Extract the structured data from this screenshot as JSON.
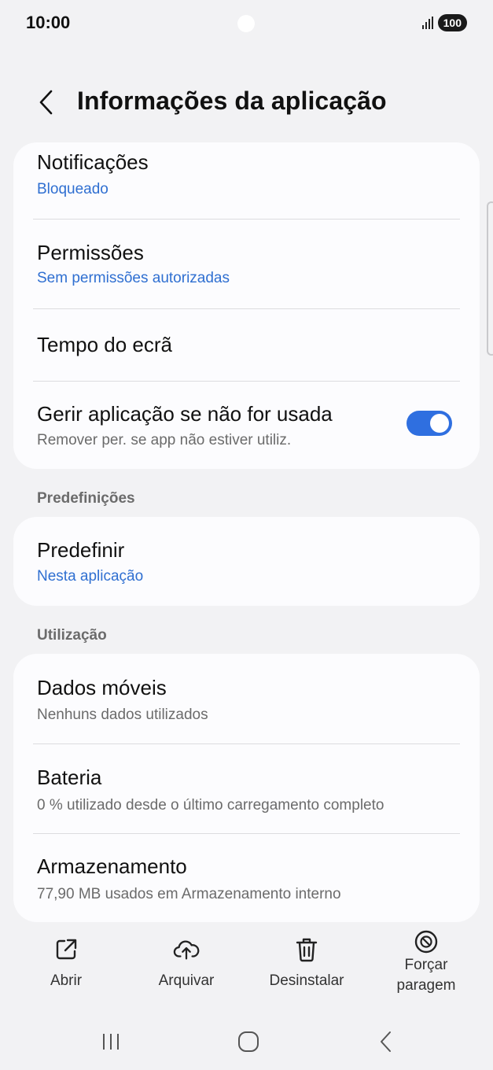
{
  "status_bar": {
    "time": "10:00",
    "battery": "100"
  },
  "header": {
    "title": "Informações da aplicação"
  },
  "card1": {
    "notifications": {
      "title": "Notificações",
      "subtitle": "Bloqueado"
    },
    "permissions": {
      "title": "Permissões",
      "subtitle": "Sem permissões autorizadas"
    },
    "screen_time": {
      "title": "Tempo do ecrã"
    },
    "manage_unused": {
      "title": "Gerir aplicação se não for usada",
      "subtitle": "Remover per. se app não estiver utiliz.",
      "toggle_on": true
    }
  },
  "defaults_section": {
    "label": "Predefinições",
    "set_default": {
      "title": "Predefinir",
      "subtitle": "Nesta aplicação"
    }
  },
  "usage_section": {
    "label": "Utilização",
    "mobile_data": {
      "title": "Dados móveis",
      "subtitle": "Nenhuns dados utilizados"
    },
    "battery": {
      "title": "Bateria",
      "subtitle": "0 % utilizado desde o último carregamento completo"
    },
    "storage": {
      "title": "Armazenamento",
      "subtitle": "77,90 MB usados em Armazenamento interno"
    }
  },
  "actions": {
    "open": "Abrir",
    "archive": "Arquivar",
    "uninstall": "Desinstalar",
    "force_stop_line1": "Forçar",
    "force_stop_line2": "paragem"
  },
  "colors": {
    "accent": "#2f6fe0",
    "link": "#2f6fd1",
    "background": "#f2f2f4",
    "card": "#fcfcfe"
  },
  "icons": [
    "back-chevron-icon",
    "open-external-icon",
    "cloud-upload-icon",
    "trash-icon",
    "block-icon",
    "recents-icon",
    "home-icon",
    "back-nav-icon"
  ]
}
